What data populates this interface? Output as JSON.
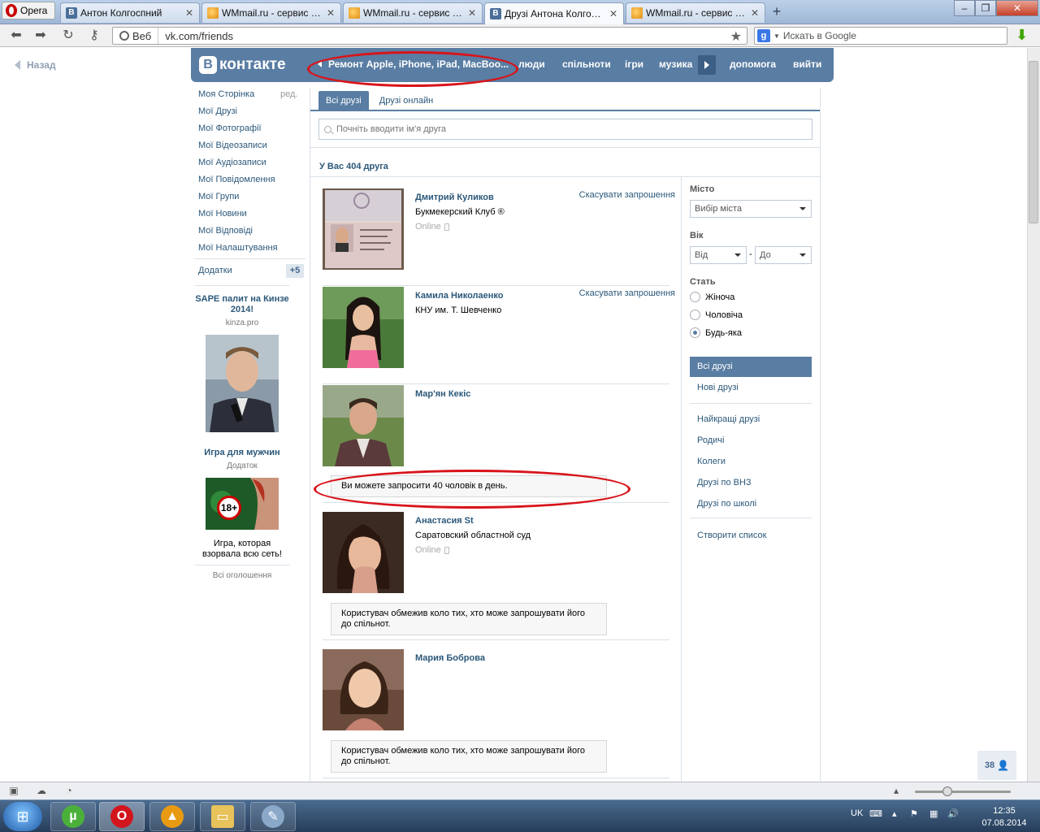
{
  "browser": {
    "opera_label": "Opera",
    "tabs": [
      {
        "label": "Антон Колгоспний",
        "icon": "vk-favicon"
      },
      {
        "label": "WMmail.ru - сервис п...",
        "icon": "wmmail-favicon"
      },
      {
        "label": "WMmail.ru - сервис п...",
        "icon": "wmmail-favicon"
      },
      {
        "label": "Друзі Антона Колгосп...",
        "icon": "vk-favicon",
        "active": true
      },
      {
        "label": "WMmail.ru - сервис п...",
        "icon": "wmmail-favicon"
      }
    ],
    "web_label": "Веб",
    "url": "vk.com/friends",
    "search_placeholder": "Искать в Google"
  },
  "page": {
    "back_label": "Назад",
    "header": {
      "logo_text": "контакте",
      "ad_link": "Ремонт Apple, iPhone, iPad, MacBoo...",
      "menu": [
        "люди",
        "спільноти",
        "ігри",
        "музика",
        "допомога",
        "вийти"
      ]
    },
    "left_menu": {
      "items": [
        "Моя Сторінка",
        "Мої Друзі",
        "Мої Фотографії",
        "Мої Відеозаписи",
        "Мої Аудіозаписи",
        "Мої Повідомлення",
        "Мої Групи",
        "Мої Новини",
        "Мої Відповіді",
        "Мої Налаштування"
      ],
      "edit_label": "ред.",
      "apps_label": "Додатки",
      "apps_count": "+5"
    },
    "ads": [
      {
        "title": "SAPE палит на Кинзе 2014!",
        "subtitle": "kinza.pro"
      },
      {
        "title": "Игра для мужчин",
        "subtitle": "Додаток",
        "text": "Игра, которая взорвала всю сеть!",
        "badge": "18+"
      }
    ],
    "all_ads_label": "Всі оголошення",
    "tabs": [
      "Всі друзі",
      "Друзі онлайн"
    ],
    "search_placeholder": "Почніть вводити ім'я друга",
    "friends_count_text": "У Вас 404 друга",
    "friends": [
      {
        "name": "Дмитрий Куликов",
        "sub": "Букмекерский Клуб ®",
        "online": "Online",
        "action": "Скасувати запрошення"
      },
      {
        "name": "Камила Николаенко",
        "sub": "КНУ им. Т. Шевченко",
        "online": "",
        "action": "Скасувати запрошення"
      },
      {
        "name": "Мар'ян Кекіс",
        "sub": "",
        "online": "",
        "action": "",
        "notice": "Ви можете запросити 40 чоловік в день."
      },
      {
        "name": "Анастасия St",
        "sub": "Саратовский областной суд",
        "online": "Online",
        "action": "",
        "notice": "Користувач обмежив коло тих, хто може запрошувати його до спільнот."
      },
      {
        "name": "Мария Боброва",
        "sub": "",
        "online": "",
        "action": "",
        "notice": "Користувач обмежив коло тих, хто може запрошувати його до спільнот."
      }
    ],
    "filters": {
      "city_label": "Місто",
      "city_select": "Вибір міста",
      "age_label": "Вік",
      "age_from": "Від",
      "age_sep": "-",
      "age_to": "До",
      "sex_label": "Стать",
      "sex_options": [
        "Жіноча",
        "Чоловіча",
        "Будь-яка"
      ],
      "sex_selected": "Будь-яка"
    },
    "right_nav": {
      "active": "Всі друзі",
      "items1": [
        "Нові друзі"
      ],
      "items2": [
        "Найкращі друзі",
        "Родичі",
        "Колеги",
        "Друзі по ВНЗ",
        "Друзі по школі"
      ],
      "create": "Створити список"
    },
    "online_counter": "38"
  },
  "taskbar": {
    "lang": "UK",
    "time": "12:35",
    "date": "07.08.2014"
  },
  "colors": {
    "vk_blue": "#597da3",
    "link": "#2b587a",
    "annotation_red": "#d8141b"
  }
}
